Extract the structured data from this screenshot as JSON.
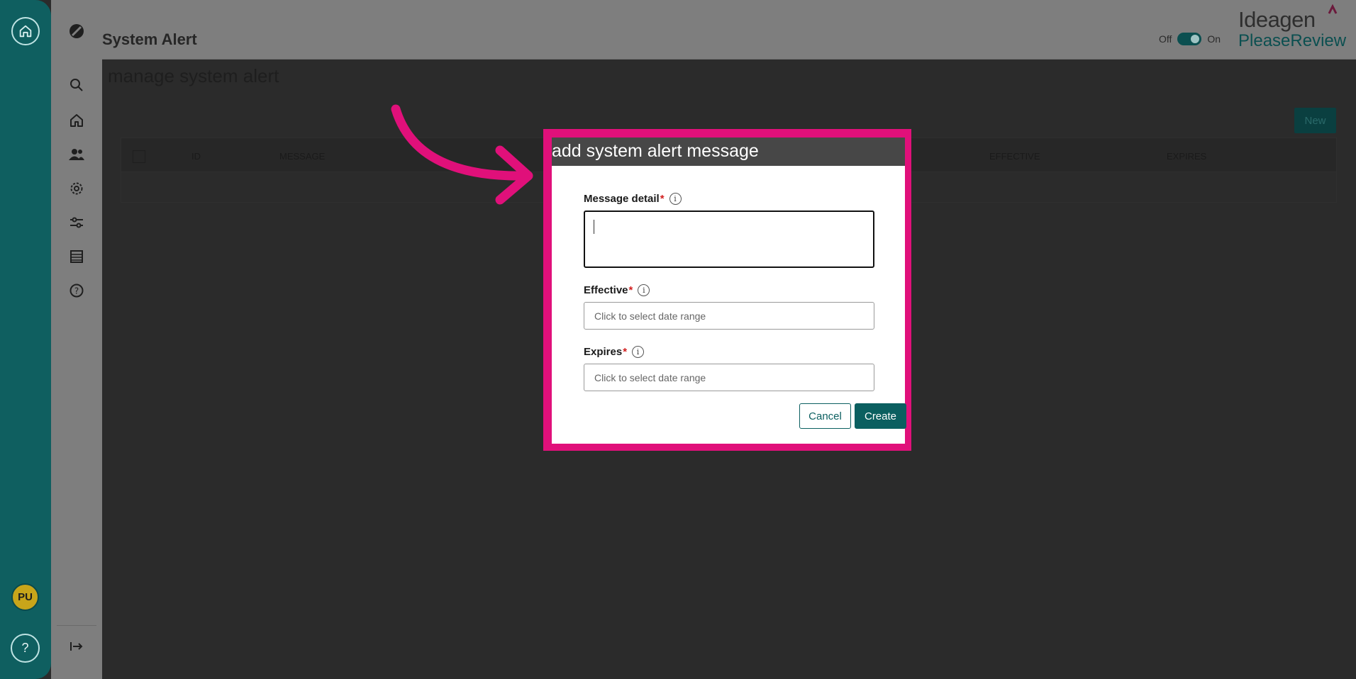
{
  "rail": {
    "avatar_initials": "PU",
    "help_glyph": "?"
  },
  "sidebar": {
    "icons": [
      "logo-icon",
      "search-icon",
      "home-icon",
      "users-icon",
      "gear-icon",
      "sliders-icon",
      "list-icon",
      "help-icon",
      "collapse-icon"
    ]
  },
  "header": {
    "title": "System Alert",
    "toggle_off": "Off",
    "toggle_on": "On",
    "toggle_state": "on",
    "brand_top": "Ideagen",
    "brand_bottom": "PleaseReview"
  },
  "content": {
    "title": "manage system alert",
    "new_button": "New",
    "columns": [
      "ID",
      "MESSAGE",
      "EFFECTIVE",
      "EXPIRES"
    ]
  },
  "modal": {
    "title": "add system alert message",
    "message_label": "Message detail",
    "message_value": "",
    "effective_label": "Effective",
    "effective_placeholder": "Click to select date range",
    "expires_label": "Expires",
    "expires_placeholder": "Click to select date range",
    "required_mark": "*",
    "info_glyph": "i",
    "cancel_label": "Cancel",
    "create_label": "Create"
  },
  "colors": {
    "accent": "#0b5f60",
    "highlight": "#e0107a",
    "rail": "#0f5f60"
  }
}
